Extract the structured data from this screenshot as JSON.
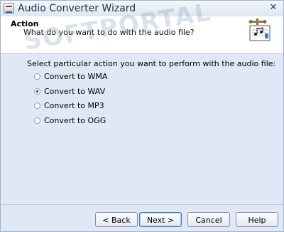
{
  "window": {
    "title": "Audio Converter Wizard",
    "close_symbol": "✕"
  },
  "header": {
    "title": "Action",
    "subtitle": "What do you want to do with the audio file?",
    "icon": "audio-file-icon"
  },
  "watermark": {
    "text": "SOFTPORTAL"
  },
  "main": {
    "prompt": "Select particular action you want to perform with the audio file:",
    "options": [
      {
        "label": "Convert to WMA",
        "checked": false
      },
      {
        "label": "Convert to WAV",
        "checked": true
      },
      {
        "label": "Convert to MP3",
        "checked": false
      },
      {
        "label": "Convert to OGG",
        "checked": false
      }
    ]
  },
  "buttons": {
    "back": "< Back",
    "next": "Next >",
    "cancel": "Cancel",
    "help": "Help"
  },
  "colors": {
    "background": "#dfe8f4",
    "header_bg": "#ffffff",
    "title_text": "#1f2f4a"
  }
}
